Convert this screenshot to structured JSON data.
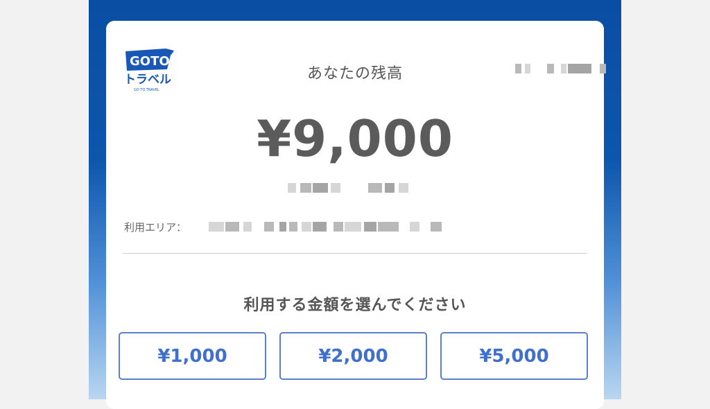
{
  "brand": {
    "logo_line1": "GOTO",
    "logo_line2": "トラベル",
    "logo_sub": "GO TO TRAVEL",
    "primary_color": "#0d56ad",
    "accent_color": "#3f6fcf"
  },
  "header": {
    "title": "あなたの残高"
  },
  "balance": {
    "amount": "¥9,000"
  },
  "area": {
    "label": "利用エリア："
  },
  "select": {
    "prompt": "利用する金額を選んでください",
    "options": [
      "¥1,000",
      "¥2,000",
      "¥5,000"
    ]
  }
}
